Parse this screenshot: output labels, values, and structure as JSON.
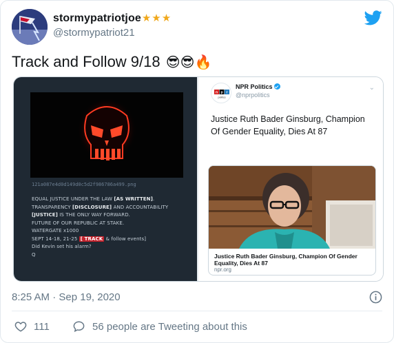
{
  "author": {
    "display_name": "stormypatriotjoe",
    "stars": "★★★",
    "handle": "@stormypatriot21"
  },
  "tweet": {
    "text": "Track and Follow 9/18",
    "emojis": "😎😎🔥"
  },
  "embedded_post": {
    "filename": "121a087e4d0d149d0c5d2f986786a499.png",
    "lines": [
      {
        "pre": "EQUAL JUSTICE UNDER THE LAW ",
        "bold": "[AS WRITTEN]",
        "post": "."
      },
      {
        "pre": "TRANSPARENCY ",
        "bold": "[DISCLOSURE]",
        "post": " AND ACCOUNTABILITY"
      },
      {
        "pre": "",
        "bold": "[JUSTICE]",
        "post": " IS THE ONLY WAY FORWARD."
      },
      {
        "pre": "FUTURE OF OUR REPUBLIC AT STAKE.",
        "bold": "",
        "post": ""
      },
      {
        "pre": "WATERGATE x1000",
        "bold": "",
        "post": ""
      },
      {
        "pre": "SEPT 14-18, 21-25 ",
        "red": "[ TRACK",
        "post": " & follow events]"
      },
      {
        "pre": "Did Kevin set his alarm?",
        "bold": "",
        "post": ""
      },
      {
        "pre": "Q",
        "bold": "",
        "post": ""
      }
    ]
  },
  "quoted_tweet": {
    "logo_text": "npr",
    "logo_sub": "politics",
    "name": "NPR Politics",
    "handle": "@nprpolitics",
    "text": "Justice Ruth Bader Ginsburg, Champion Of Gender Equality, Dies At 87",
    "card_title": "Justice Ruth Bader Ginsburg, Champion Of Gender Equality, Dies At 87",
    "card_domain": "npr.org"
  },
  "footer": {
    "timestamp": "8:25 AM · Sep 19, 2020",
    "likes": "111",
    "replies": "56 people are Tweeting about this"
  },
  "colors": {
    "twitter_blue": "#1da1f2",
    "star": "#f0a81c",
    "muted": "#657786",
    "track_red": "#c3232d"
  },
  "icons": [
    "twitter-bird-icon",
    "info-icon",
    "heart-icon",
    "reply-bubble-icon",
    "verified-badge-icon",
    "chevron-down-icon"
  ]
}
